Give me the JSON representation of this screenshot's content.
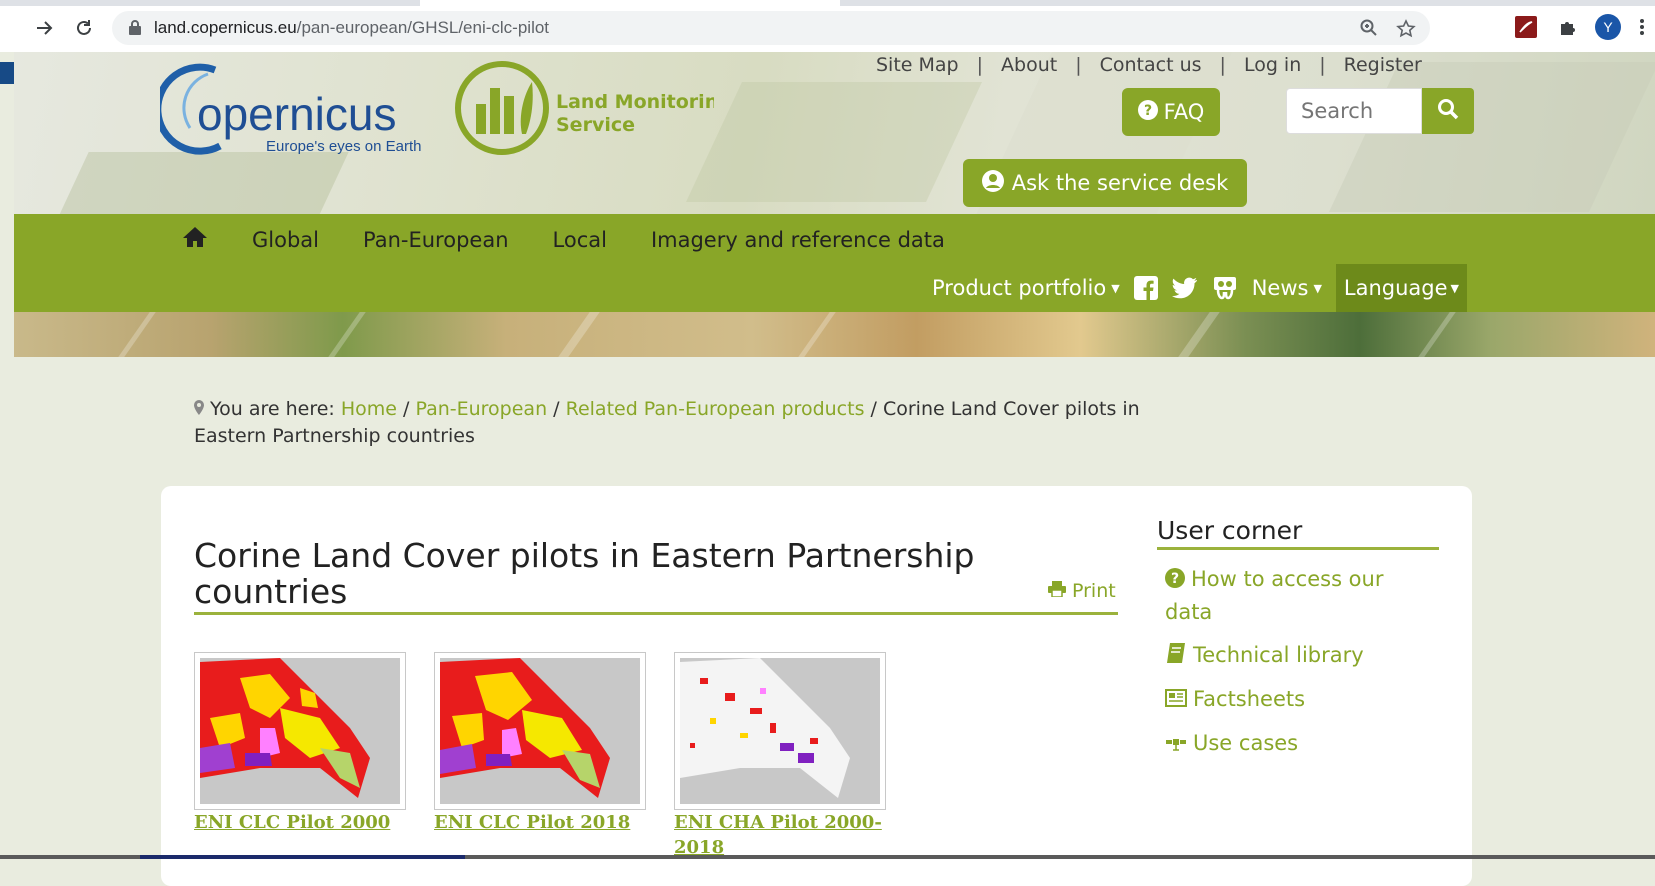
{
  "browser": {
    "url_host": "land.copernicus.eu",
    "url_path": "/pan-european/GHSL/eni-clc-pilot",
    "avatar_letter": "Y"
  },
  "header": {
    "logo_copernicus": "opernicus",
    "logo_copernicus_tagline": "Europe's eyes on Earth",
    "logo_lms_line1": "Land Monitoring",
    "logo_lms_line2": "Service",
    "top_links": [
      "Site Map",
      "About",
      "Contact us",
      "Log in",
      "Register"
    ],
    "faq_label": "FAQ",
    "search_placeholder": "Search",
    "desk_label": "Ask the service desk"
  },
  "nav": {
    "primary": [
      "Global",
      "Pan-European",
      "Local",
      "Imagery and reference data"
    ],
    "product_portfolio": "Product portfolio",
    "news": "News",
    "language": "Language"
  },
  "breadcrumb": {
    "prefix": "You are here:",
    "items": [
      "Home",
      "Pan-European",
      "Related Pan-European products"
    ],
    "current": "Corine Land Cover pilots in Eastern Partnership countries"
  },
  "page": {
    "title": "Corine Land Cover pilots in Eastern Partnership countries",
    "print_label": "Print",
    "thumbnails": [
      {
        "label": "ENI CLC Pilot 2000"
      },
      {
        "label": "ENI CLC Pilot 2018"
      },
      {
        "label": "ENI CHA Pilot 2000-2018"
      }
    ]
  },
  "user_corner": {
    "title": "User corner",
    "items": [
      "How to access our data",
      "Technical library",
      "Factsheets",
      "Use cases"
    ]
  },
  "colors": {
    "accent_green": "#89a628",
    "dark_green": "#6d8a1a"
  }
}
